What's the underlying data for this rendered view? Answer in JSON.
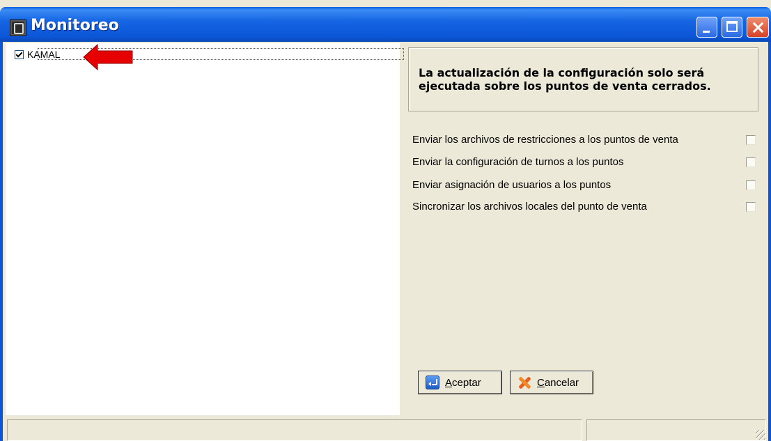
{
  "window": {
    "title": "Monitoreo",
    "icon": "app-icon",
    "controls": [
      "minimize-icon",
      "maximize-icon",
      "close-icon"
    ]
  },
  "tree": {
    "items": [
      {
        "label": "KAMAL",
        "checked": true
      }
    ]
  },
  "annotation": {
    "icon": "red-arrow-icon",
    "color": "#e60000"
  },
  "info": {
    "message": "La actualización de la configuración solo será ejecutada sobre los puntos de venta cerrados."
  },
  "options": [
    {
      "label": "Enviar los archivos de restricciones a los puntos de venta",
      "checked": false
    },
    {
      "label": "Enviar la configuración de turnos a los puntos",
      "checked": false
    },
    {
      "label": "Enviar asignación de usuarios a los puntos",
      "checked": false
    },
    {
      "label": "Sincronizar los archivos locales del punto de venta",
      "checked": false
    }
  ],
  "buttons": {
    "accept": {
      "label": "Aceptar",
      "icon": "enter-icon"
    },
    "cancel": {
      "label": "Cancelar",
      "icon": "cancel-x-icon"
    }
  },
  "statusbar": {
    "panes": [
      "",
      ""
    ]
  },
  "colors": {
    "titlebar": "#0b56d8",
    "face": "#ece9d8",
    "accent": "#e60000"
  }
}
